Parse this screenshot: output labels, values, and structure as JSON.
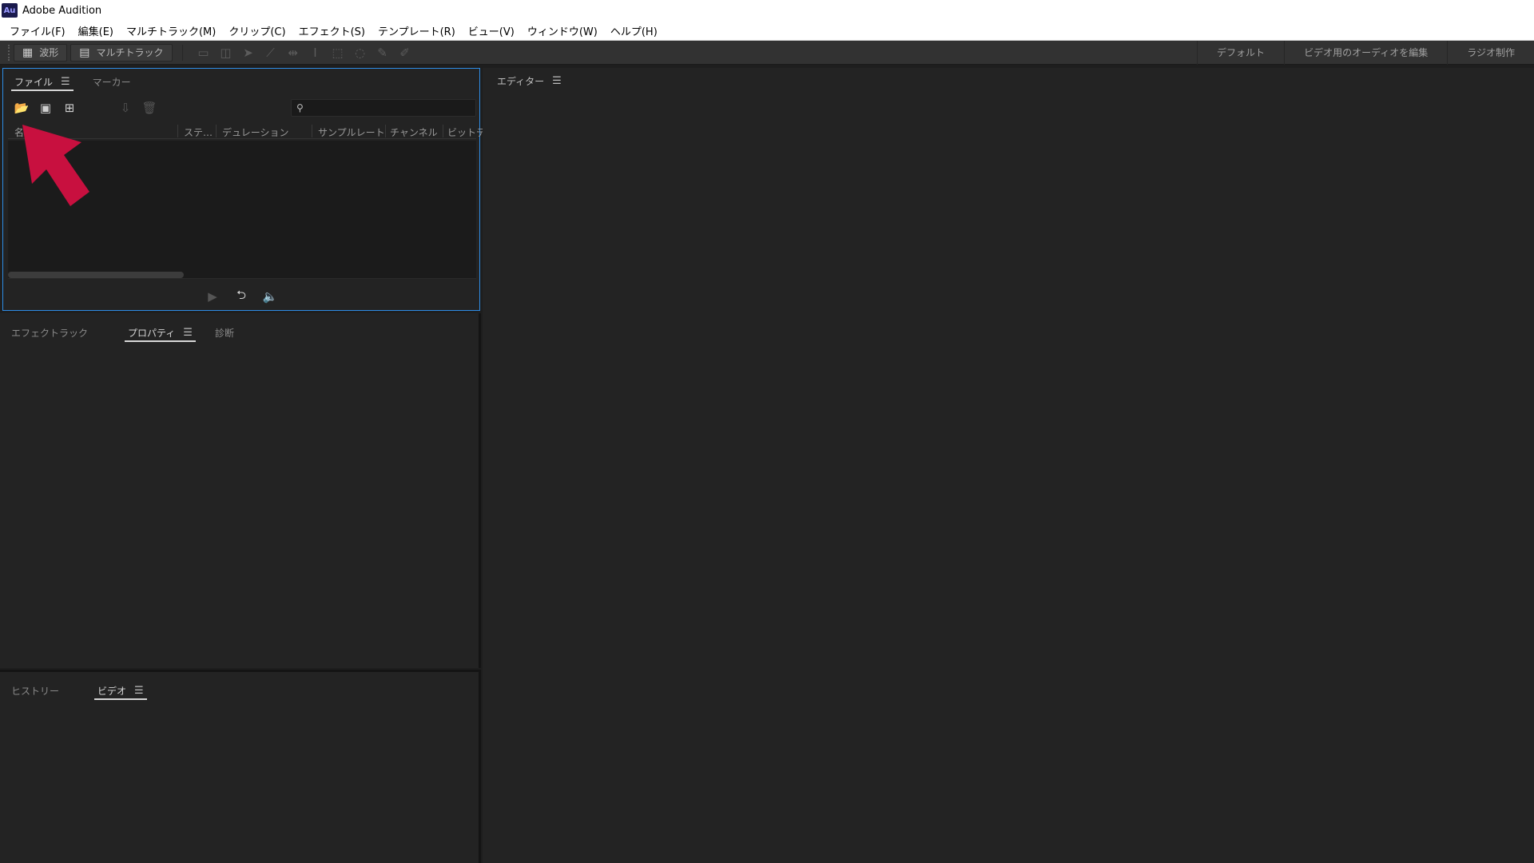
{
  "app": {
    "logo": "Au",
    "title": "Adobe Audition"
  },
  "menu": {
    "items": [
      "ファイル(F)",
      "編集(E)",
      "マルチトラック(M)",
      "クリップ(C)",
      "エフェクト(S)",
      "テンプレート(R)",
      "ビュー(V)",
      "ウィンドウ(W)",
      "ヘルプ(H)"
    ]
  },
  "toolbar": {
    "waveform_label": "波形",
    "multitrack_label": "マルチトラック",
    "workspaces": [
      "デフォルト",
      "ビデオ用のオーディオを編集",
      "ラジオ制作"
    ]
  },
  "files_panel": {
    "tabs": [
      "ファイル",
      "マーカー"
    ],
    "columns": [
      "名前",
      "ステ…",
      "デュレーション",
      "サンプルレート",
      "チャンネル",
      "ビットデ"
    ]
  },
  "props_panel": {
    "tabs": [
      "エフェクトラック",
      "プロパティ",
      "診断"
    ]
  },
  "history_panel": {
    "tabs": [
      "ヒストリー",
      "ビデオ"
    ]
  },
  "editor_panel": {
    "title": "エディター"
  },
  "icons": {
    "menu": "☰",
    "arrow_color": "#c8103f"
  }
}
